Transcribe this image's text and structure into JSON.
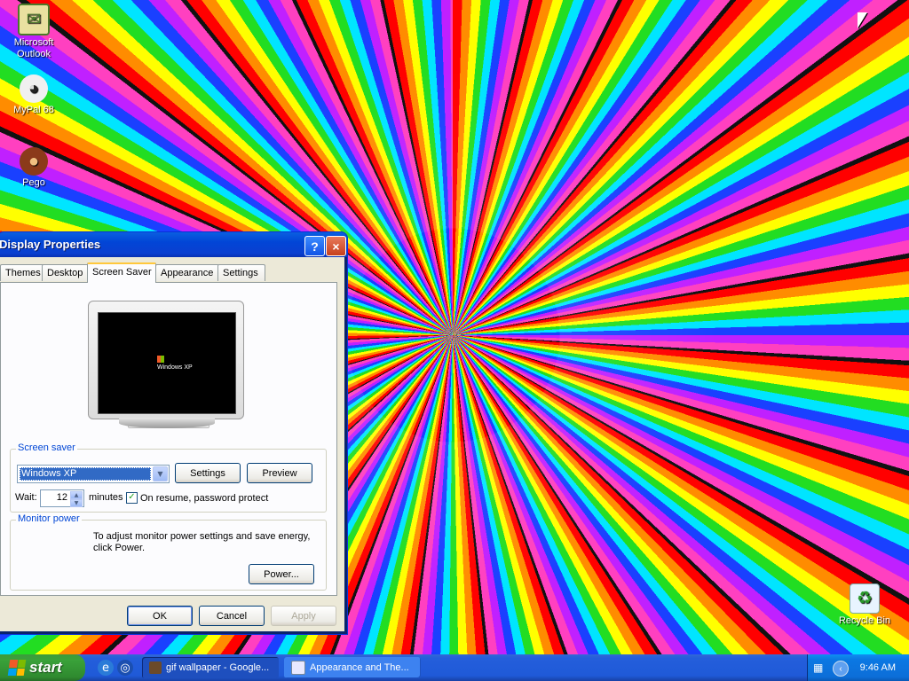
{
  "desktop": {
    "icons": [
      {
        "name": "outlook",
        "label": "Microsoft Outlook"
      },
      {
        "name": "mypal",
        "label": "MyPal 68"
      },
      {
        "name": "pego",
        "label": "Pego"
      },
      {
        "name": "recycle",
        "label": "Recycle Bin"
      }
    ]
  },
  "window": {
    "title": "Display Properties",
    "help_button": "?",
    "close_button": "×",
    "tabs": [
      {
        "label": "Themes"
      },
      {
        "label": "Desktop"
      },
      {
        "label": "Screen Saver"
      },
      {
        "label": "Appearance"
      },
      {
        "label": "Settings"
      }
    ],
    "active_tab": "Screen Saver",
    "preview_logo_text": "Windows XP",
    "screen_saver": {
      "group_label": "Screen saver",
      "selected": "Windows XP",
      "settings_button": "Settings",
      "preview_button": "Preview",
      "wait_label": "Wait:",
      "wait_value": "12",
      "minutes_label": "minutes",
      "password_label": "On resume, password protect",
      "password_checked": true
    },
    "monitor_power": {
      "group_label": "Monitor power",
      "description": "To adjust monitor power settings and save energy, click Power.",
      "power_button": "Power..."
    },
    "buttons": {
      "ok": "OK",
      "cancel": "Cancel",
      "apply": "Apply"
    }
  },
  "taskbar": {
    "start_label": "start",
    "tasks": [
      {
        "label": "gif wallpaper - Google..."
      },
      {
        "label": "Appearance and The..."
      }
    ],
    "clock": "9:46 AM"
  }
}
